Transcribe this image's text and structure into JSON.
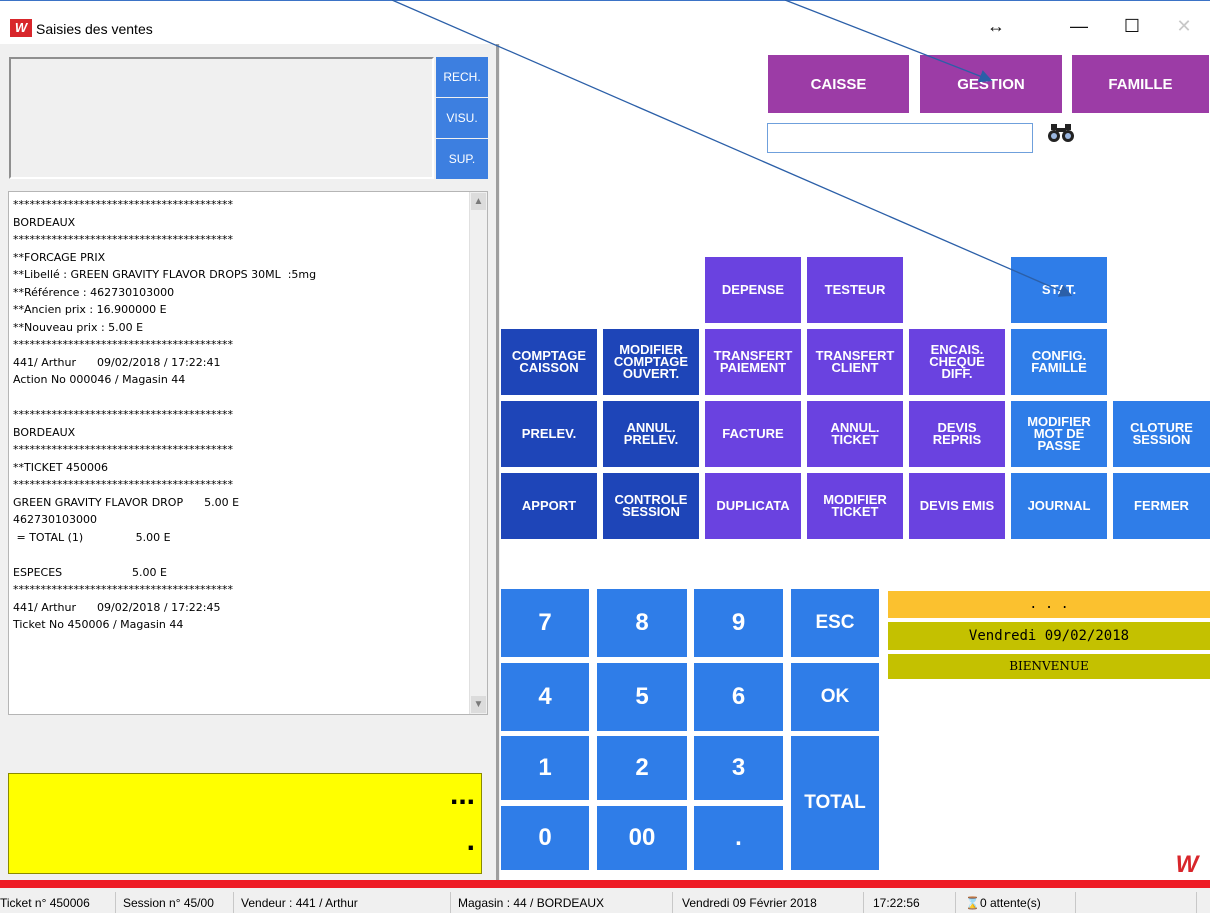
{
  "window": {
    "title": "Saisies des ventes",
    "app_icon": "app-logo",
    "controls": {
      "move": "↔",
      "minimize": "—",
      "maximize": "☐",
      "close": "✕"
    }
  },
  "left_panel": {
    "side_buttons": {
      "search": "RECH.",
      "view": "VISU.",
      "delete": "SUP."
    },
    "log_lines": [
      "****************************************",
      "BORDEAUX",
      "****************************************",
      "**FORCAGE PRIX",
      "**Libellé : GREEN GRAVITY FLAVOR DROPS 30ML  :5mg",
      "**Référence : 462730103000",
      "**Ancien prix : 16.900000 E",
      "**Nouveau prix : 5.00 E",
      "****************************************",
      "441/ Arthur      09/02/2018 / 17:22:41",
      "Action No 000046 / Magasin 44",
      "",
      "****************************************",
      "BORDEAUX",
      "****************************************",
      "**TICKET 450006",
      "****************************************",
      "GREEN GRAVITY FLAVOR DROP      5.00 E",
      "462730103000",
      " = TOTAL (1)               5.00 E",
      "",
      "ESPECES                    5.00 E",
      "****************************************",
      "441/ Arthur      09/02/2018 / 17:22:45",
      "Ticket No 450006 / Magasin 44"
    ],
    "display": {
      "top": "...",
      "bottom": "."
    }
  },
  "top_buttons": {
    "caisse": "CAISSE",
    "gestion": "GESTION",
    "famille": "FAMILLE"
  },
  "search": {
    "value": "",
    "icon": "binoculars-icon"
  },
  "functions": {
    "depense": "DEPENSE",
    "testeur": "TESTEUR",
    "stat": "STAT.",
    "comptage_caisson": "COMPTAGE\nCAISSON",
    "modifier_comptage": "MODIFIER\nCOMPTAGE\nOUVERT.",
    "transfert_paiement": "TRANSFERT\nPAIEMENT",
    "transfert_client": "TRANSFERT\nCLIENT",
    "encais_cheque": "ENCAIS.\nCHEQUE\nDIFF.",
    "config_famille": "CONFIG.\nFAMILLE",
    "prelev": "PRELEV.",
    "annul_prelev": "ANNUL.\nPRELEV.",
    "facture": "FACTURE",
    "annul_ticket": "ANNUL.\nTICKET",
    "devis_repris": "DEVIS\nREPRIS",
    "modifier_mdp": "MODIFIER\nMOT DE\nPASSE",
    "cloture_session": "CLOTURE\nSESSION",
    "apport": "APPORT",
    "controle_session": "CONTROLE\nSESSION",
    "duplicata": "DUPLICATA",
    "modifier_ticket": "MODIFIER\nTICKET",
    "devis_emis": "DEVIS EMIS",
    "journal": "JOURNAL",
    "fermer": "FERMER"
  },
  "keypad": {
    "k7": "7",
    "k8": "8",
    "k9": "9",
    "esc": "ESC",
    "k4": "4",
    "k5": "5",
    "k6": "6",
    "ok": "OK",
    "k1": "1",
    "k2": "2",
    "k3": "3",
    "total": "TOTAL",
    "k0": "0",
    "k00": "00",
    "dot": "."
  },
  "info": {
    "dots": ". . .",
    "date": "Vendredi 09/02/2018",
    "welcome": "BIENVENUE"
  },
  "status": {
    "ticket": "Ticket n° 450006",
    "session": "Session n° 45/00",
    "vendeur": "Vendeur : 441 / Arthur",
    "magasin": "Magasin : 44 / BORDEAUX",
    "date": "Vendredi 09 Février 2018",
    "time": "17:22:56",
    "attente": "0 attente(s)"
  },
  "colors": {
    "accent_purple": "#9c3ca6",
    "navy": "#1e45b8",
    "violet": "#6a42e0",
    "blue": "#2f7de8",
    "display_yellow": "#ffff00",
    "status_red": "#ee1c25"
  }
}
